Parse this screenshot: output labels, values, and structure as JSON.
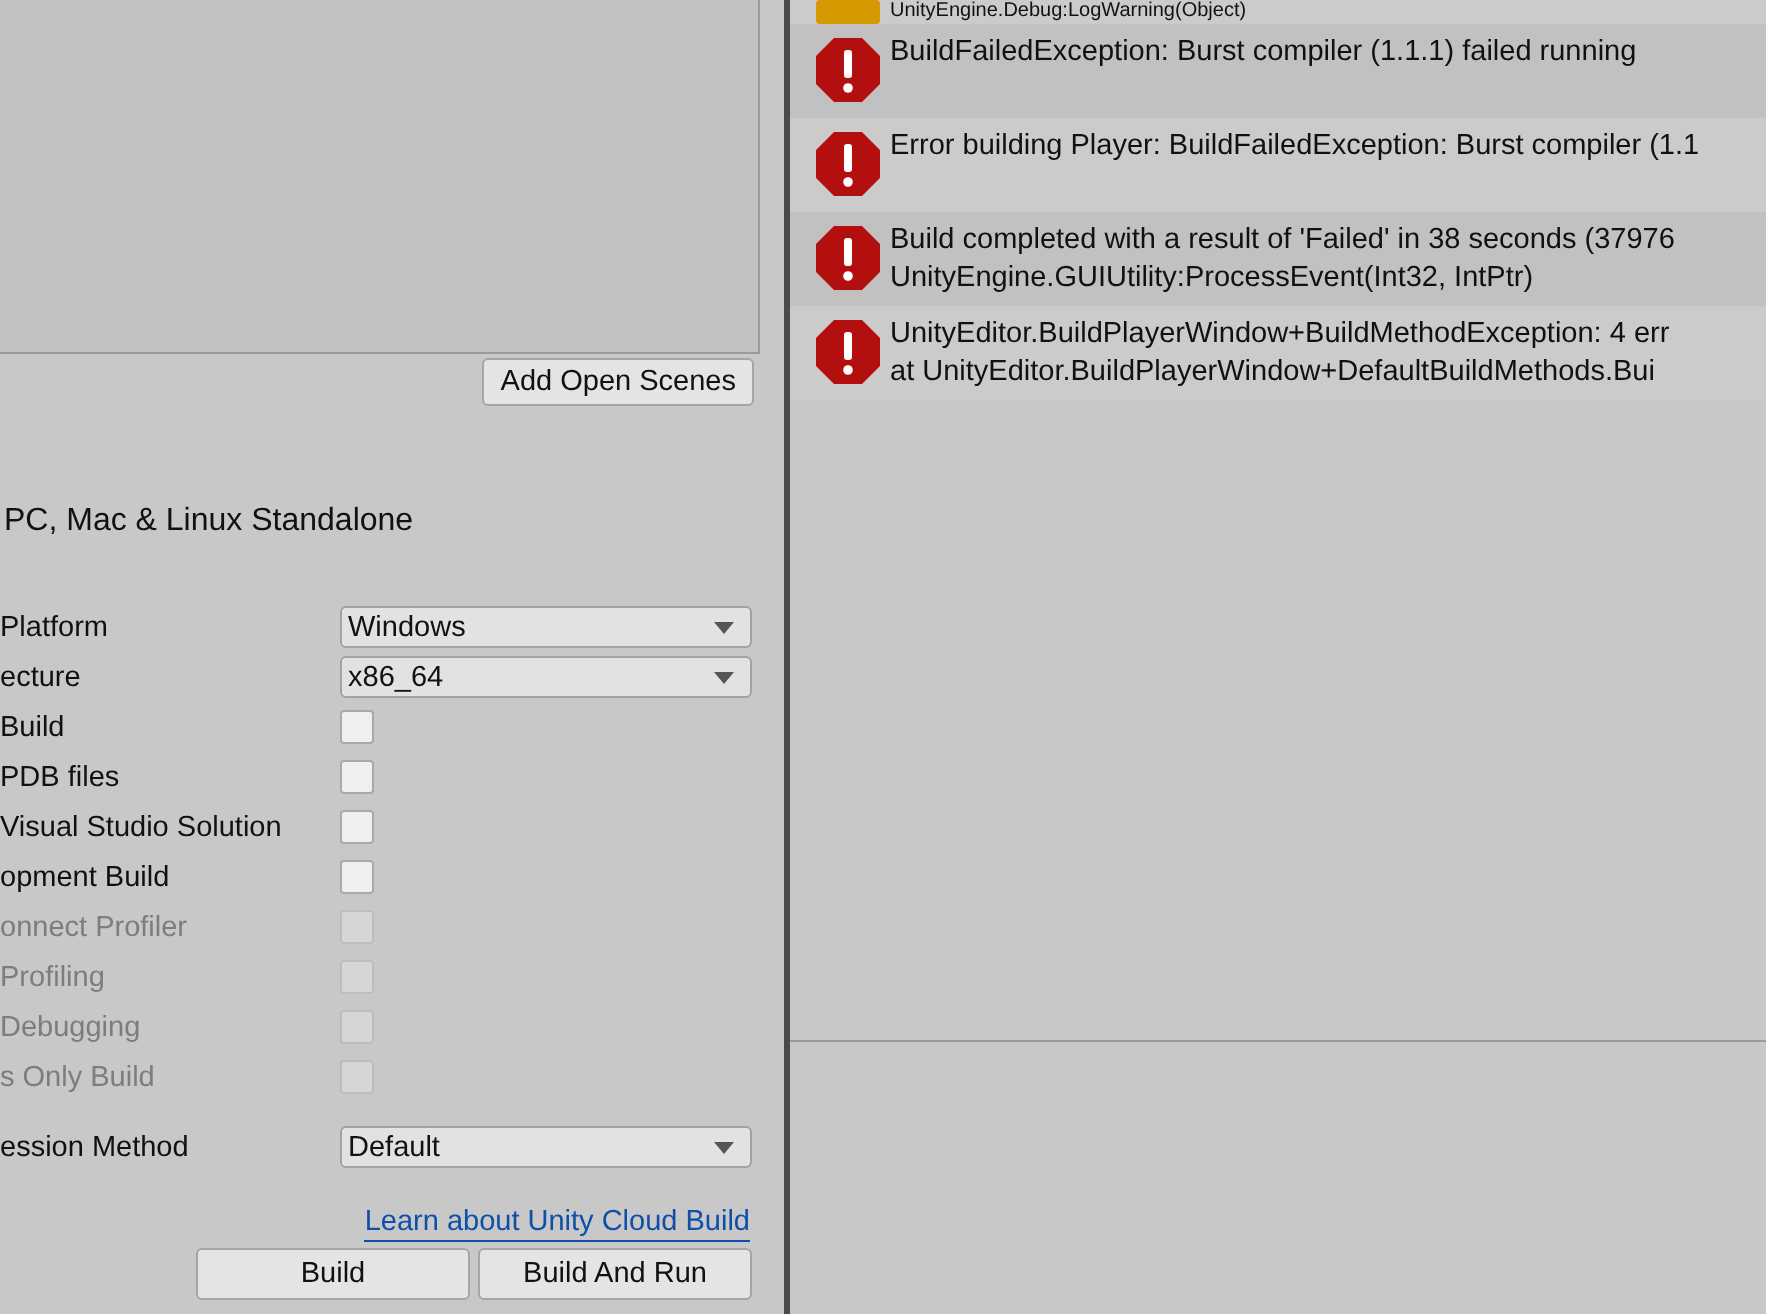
{
  "scene_list": {
    "add_button": "Add Open Scenes"
  },
  "platform": {
    "title": "PC, Mac & Linux Standalone"
  },
  "settings": [
    {
      "kind": "dropdown",
      "label": "Platform",
      "value": "Windows"
    },
    {
      "kind": "dropdown",
      "label": "ecture",
      "value": "x86_64"
    },
    {
      "kind": "checkbox",
      "label": "Build",
      "checked": false,
      "disabled": false
    },
    {
      "kind": "checkbox",
      "label": "PDB files",
      "checked": false,
      "disabled": false
    },
    {
      "kind": "checkbox",
      "label": "Visual Studio Solution",
      "checked": false,
      "disabled": false
    },
    {
      "kind": "checkbox",
      "label": "opment Build",
      "checked": false,
      "disabled": false
    },
    {
      "kind": "checkbox",
      "label": "onnect Profiler",
      "checked": false,
      "disabled": true
    },
    {
      "kind": "checkbox",
      "label": "Profiling",
      "checked": false,
      "disabled": true
    },
    {
      "kind": "checkbox",
      "label": "Debugging",
      "checked": false,
      "disabled": true
    },
    {
      "kind": "checkbox",
      "label": "s Only Build",
      "checked": false,
      "disabled": true
    },
    {
      "kind": "dropdown",
      "label": "ession Method",
      "value": "Default"
    }
  ],
  "cloud_link": "Learn about Unity Cloud Build",
  "buttons": [
    "Build",
    "Build And Run"
  ],
  "console": [
    {
      "kind": "warning",
      "lines": [
        "UnityEngine.Debug:LogWarning(Object)"
      ]
    },
    {
      "kind": "error",
      "lines": [
        "BuildFailedException: Burst compiler (1.1.1) failed running"
      ]
    },
    {
      "kind": "error",
      "lines": [
        "Error building Player: BuildFailedException: Burst compiler (1.1"
      ]
    },
    {
      "kind": "error",
      "lines": [
        "Build completed with a result of 'Failed' in 38 seconds (37976",
        "UnityEngine.GUIUtility:ProcessEvent(Int32, IntPtr)"
      ]
    },
    {
      "kind": "error",
      "lines": [
        "UnityEditor.BuildPlayerWindow+BuildMethodException: 4 err",
        " at UnityEditor.BuildPlayerWindow+DefaultBuildMethods.Bui"
      ]
    }
  ]
}
